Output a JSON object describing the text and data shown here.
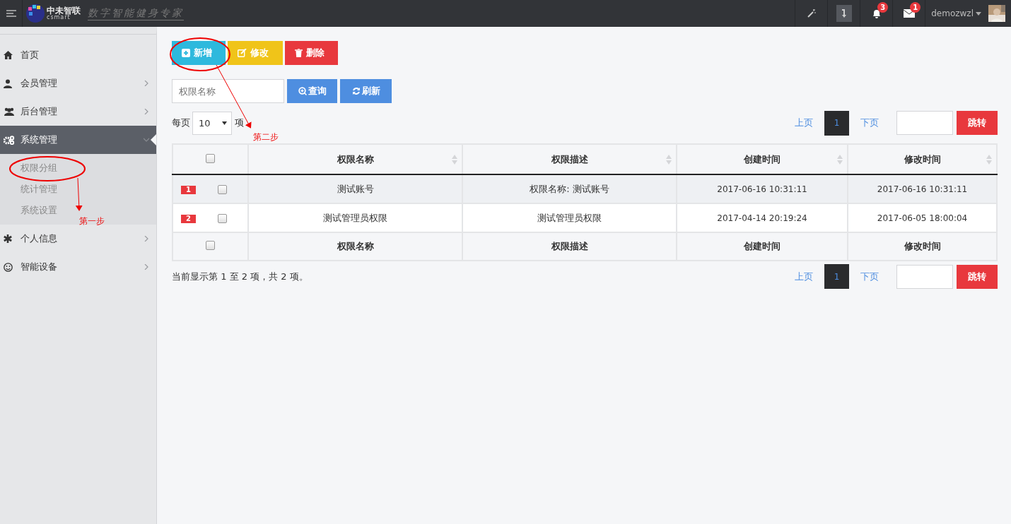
{
  "topbar": {
    "logo": {
      "name": "中未智联",
      "sub": "csmart",
      "slogan": "数字智能健身专家"
    },
    "notifications": {
      "count": "3"
    },
    "messages": {
      "count": "1"
    },
    "user": {
      "name": "demozwzl"
    }
  },
  "sidebar": {
    "items": [
      {
        "label": "首页",
        "expandable": false,
        "selected": false
      },
      {
        "label": "会员管理",
        "expandable": true,
        "expanded": false,
        "selected": false
      },
      {
        "label": "后台管理",
        "expandable": true,
        "expanded": false,
        "selected": false
      },
      {
        "label": "系统管理",
        "expandable": true,
        "expanded": true,
        "selected": true,
        "children": [
          {
            "label": "权限分组",
            "selected": false
          },
          {
            "label": "统计管理",
            "selected": false
          },
          {
            "label": "系统设置",
            "selected": false
          }
        ]
      },
      {
        "label": "个人信息",
        "expandable": true,
        "expanded": false,
        "selected": false
      },
      {
        "label": "智能设备",
        "expandable": true,
        "expanded": false,
        "selected": false
      }
    ]
  },
  "actions": [
    {
      "kind": "add",
      "label": "新增"
    },
    {
      "kind": "edit",
      "label": "修改"
    },
    {
      "kind": "delete",
      "label": "删除"
    }
  ],
  "search": {
    "placeholder": "权限名称",
    "buttons": [
      {
        "kind": "query",
        "label": "查询"
      },
      {
        "kind": "refresh",
        "label": "刷新"
      }
    ]
  },
  "page_size": {
    "prefix": "每页",
    "value": "10",
    "suffix": "项"
  },
  "pagers": [
    {
      "prev": "上页",
      "page": "1",
      "next": "下页",
      "go": "跳转"
    },
    {
      "prev": "上页",
      "page": "1",
      "next": "下页",
      "go": "跳转"
    }
  ],
  "table": {
    "header_checked": false,
    "footer_checked": false,
    "columns": [
      {
        "label": "权限名称",
        "sortable": true
      },
      {
        "label": "权限描述",
        "sortable": true
      },
      {
        "label": "创建时间",
        "sortable": true
      },
      {
        "label": "修改时间",
        "sortable": true
      }
    ],
    "rows": [
      {
        "number": "1",
        "checked": false,
        "striped": true,
        "cells": [
          "测试账号",
          "权限名称: 测试账号",
          "2017-06-16 10:31:11",
          "2017-06-16 10:31:11"
        ]
      },
      {
        "number": "2",
        "checked": false,
        "striped": false,
        "cells": [
          "测试管理员权限",
          "测试管理员权限",
          "2017-04-14 20:19:24",
          "2017-06-05 18:00:04"
        ]
      }
    ],
    "footer": [
      "权限名称",
      "权限描述",
      "创建时间",
      "修改时间"
    ]
  },
  "summary": "当前显示第 1 至 2 项，共 2 项。",
  "annotations": [
    {
      "label": "第一步"
    },
    {
      "label": "第二步"
    }
  ]
}
